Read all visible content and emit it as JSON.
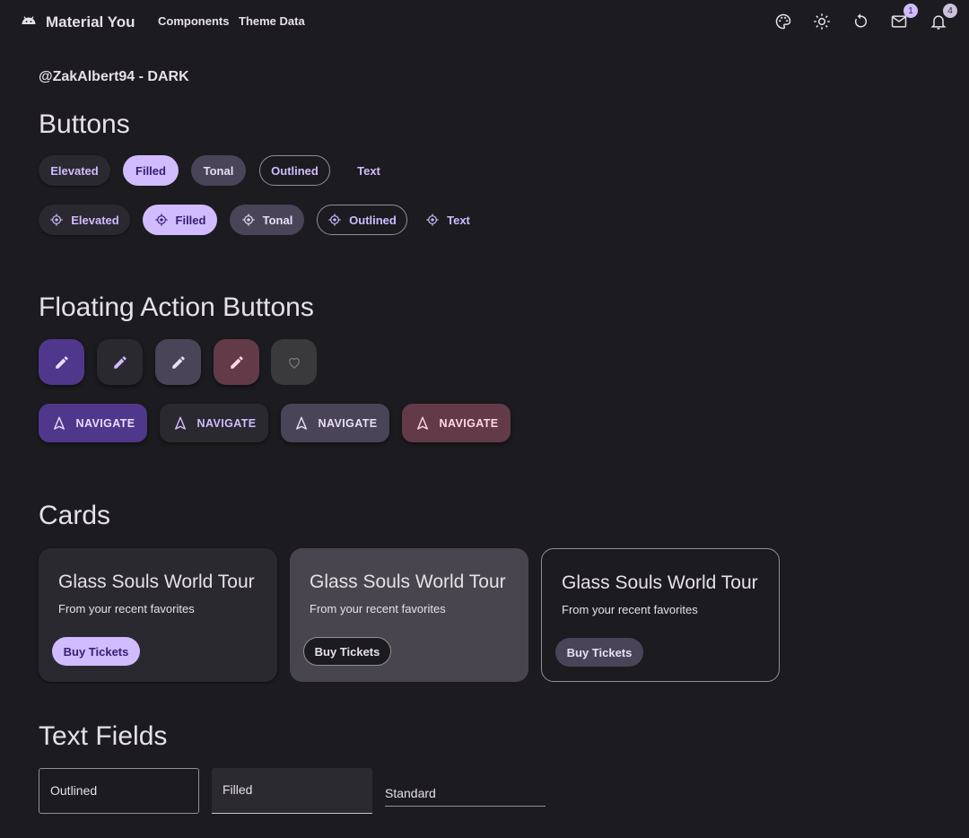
{
  "header": {
    "brand_title": "Material You",
    "nav": [
      "Components",
      "Theme Data"
    ],
    "icons": [
      "palette-icon",
      "brightness-icon",
      "refresh-icon",
      "mail-icon",
      "notifications-icon"
    ],
    "mail_badge": "1",
    "notifications_badge": "4"
  },
  "user_line": "@ZakAlbert94 - DARK",
  "sections": {
    "buttons": "Buttons",
    "fabs": "Floating Action Buttons",
    "cards": "Cards",
    "text_fields": "Text Fields"
  },
  "buttons": {
    "row1": [
      "Elevated",
      "Filled",
      "Tonal",
      "Outlined",
      "Text"
    ],
    "row2": [
      "Elevated",
      "Filled",
      "Tonal",
      "Outlined",
      "Text"
    ],
    "row2_icon": "gps-fixed-icon"
  },
  "fabs": {
    "icons": [
      "edit-icon",
      "edit-icon",
      "edit-icon",
      "edit-icon",
      "favorite-border-icon"
    ],
    "extended_label": "NAVIGATE",
    "extended_icon": "navigation-icon"
  },
  "cards": [
    {
      "title": "Glass Souls World Tour",
      "subtitle": "From your recent favorites",
      "button": "Buy Tickets"
    },
    {
      "title": "Glass Souls World Tour",
      "subtitle": "From your recent favorites",
      "button": "Buy Tickets"
    },
    {
      "title": "Glass Souls World Tour",
      "subtitle": "From your recent favorites",
      "button": "Buy Tickets"
    }
  ],
  "text_fields": {
    "outlined_label": "Outlined",
    "filled_label": "Filled",
    "standard_label": "Standard"
  },
  "colors": {
    "background": "#1c1b1f",
    "primary": "#d0bcff",
    "on_primary": "#381e72",
    "secondary_container": "#4a4458",
    "tertiary_container": "#633b48",
    "primary_container": "#4f378b"
  }
}
